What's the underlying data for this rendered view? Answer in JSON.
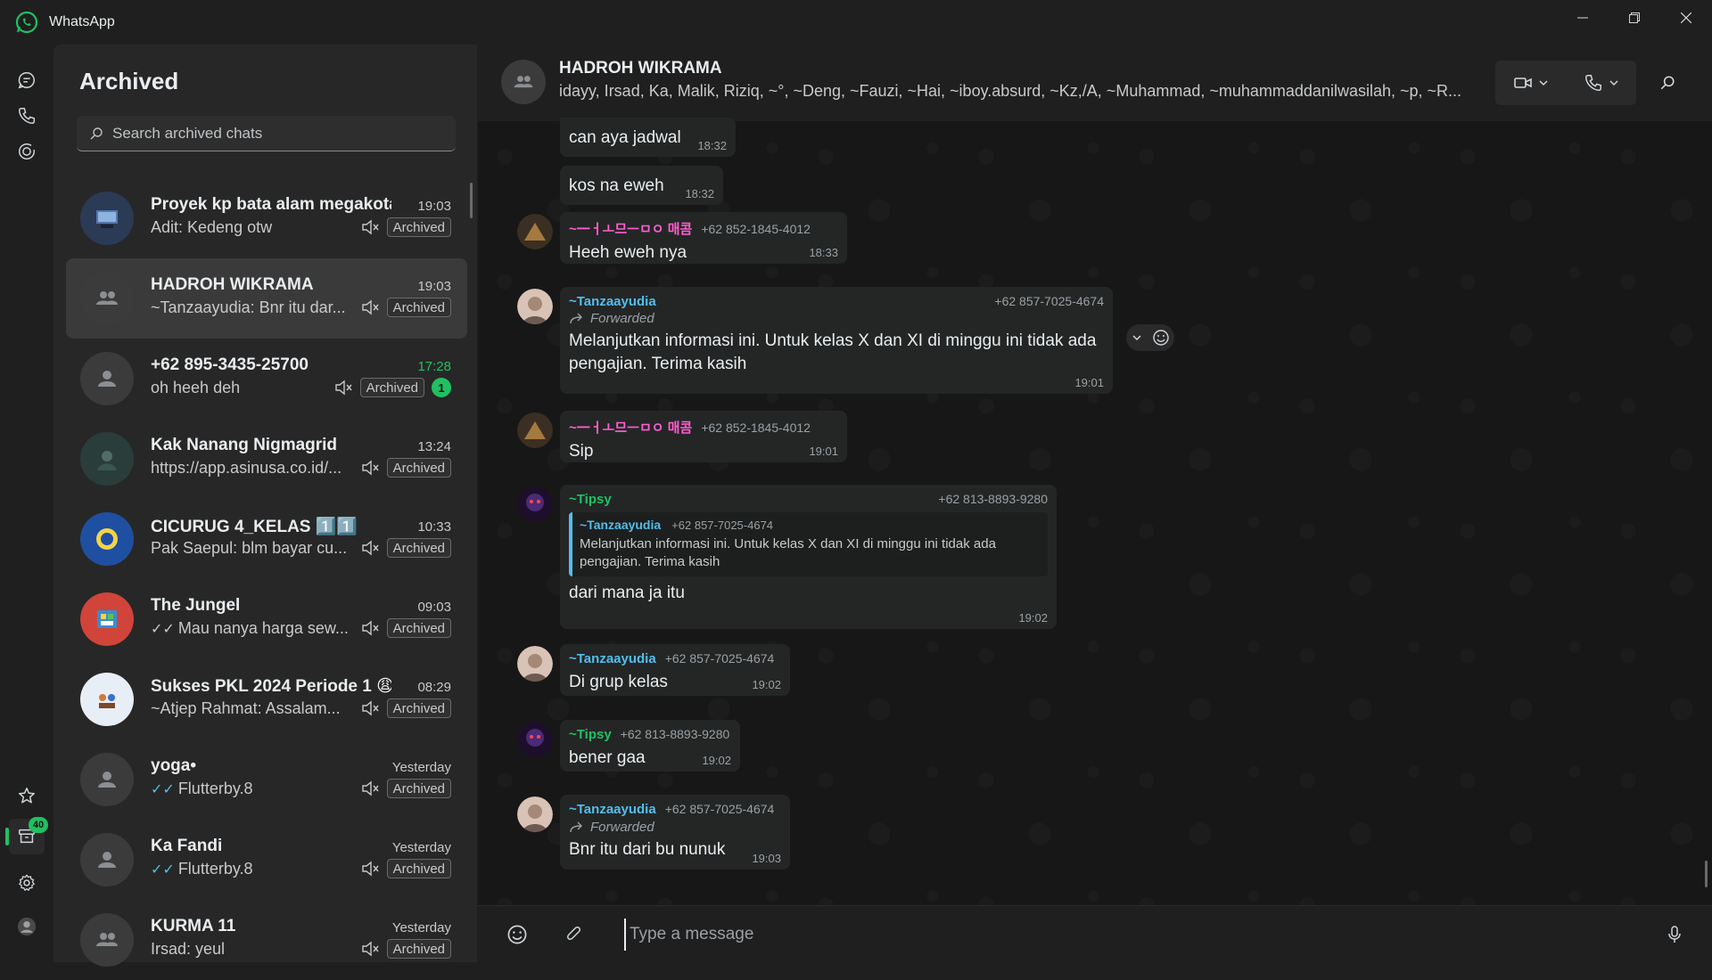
{
  "app": {
    "title": "WhatsApp",
    "accent": "#21c063"
  },
  "rail": {
    "archived_badge": "40"
  },
  "sidebar": {
    "title": "Archived",
    "search_placeholder": "Search archived chats",
    "chats": [
      {
        "name": "Proyek kp bata alam megakota",
        "time": "19:03",
        "preview": "Adit: Kedeng otw",
        "badge": "Archived"
      },
      {
        "name": "HADROH WIKRAMA",
        "time": "19:03",
        "preview": "~Tanzaayudia: Bnr itu dar...",
        "badge": "Archived"
      },
      {
        "name": "+62 895-3435-25700",
        "time": "17:28",
        "preview": "oh heeh deh",
        "badge": "Archived",
        "unread": "1"
      },
      {
        "name": "Kak Nanang Nigmagrid",
        "time": "13:24",
        "preview": "https://app.asinusa.co.id/...",
        "badge": "Archived"
      },
      {
        "name": "CICURUG 4_KELAS 1️⃣1️⃣",
        "time": "10:33",
        "preview": "Pak Saepul: blm bayar cu...",
        "badge": "Archived"
      },
      {
        "name": "The Jungel",
        "time": "09:03",
        "preview": "Mau nanya harga sew...",
        "badge": "Archived"
      },
      {
        "name": "Sukses PKL 2024 Periode 1 😩😩",
        "time": "08:29",
        "preview": "~Atjep Rahmat: Assalam...",
        "badge": "Archived"
      },
      {
        "name": "yoga•",
        "time": "Yesterday",
        "preview": "Flutterby.8",
        "badge": "Archived"
      },
      {
        "name": "Ka Fandi",
        "time": "Yesterday",
        "preview": "Flutterby.8",
        "badge": "Archived"
      },
      {
        "name": "KURMA 11",
        "time": "Yesterday",
        "preview": "Irsad: yeul",
        "badge": "Archived"
      }
    ]
  },
  "conversation": {
    "title": "HADROH WIKRAMA",
    "members": "idayy, Irsad, Ka, Malik, Riziq, ~°, ~Deng, ~Fauzi, ~Hai, ~iboy.absurd, ~Kz,/A, ~Muhammad, ~muhammaddanilwasilah, ~p, ~R...",
    "messages": [
      {
        "text": "can aya jadwal",
        "time": "18:32"
      },
      {
        "text": "kos na eweh",
        "time": "18:32"
      },
      {
        "sender": "~一ㅓㅗ므ㅡㅁㅇ 매콤",
        "phone": "+62 852-1845-4012",
        "text": "Heeh eweh nya",
        "time": "18:33"
      },
      {
        "sender": "~Tanzaayudia",
        "phone": "+62 857-7025-4674",
        "forwarded": "Forwarded",
        "text": "Melanjutkan informasi ini. Untuk kelas X dan XI di minggu ini tidak ada pengajian. Terima kasih",
        "time": "19:01"
      },
      {
        "sender": "~一ㅓㅗ므ㅡㅁㅇ 매콤",
        "phone": "+62 852-1845-4012",
        "text": "Sip",
        "time": "19:01"
      },
      {
        "sender": "~Tipsy",
        "phone": "+62 813-8893-9280",
        "quote_name": "~Tanzaayudia",
        "quote_phone": "+62 857-7025-4674",
        "quote_text": "Melanjutkan informasi ini. Untuk kelas X dan XI di minggu ini tidak ada pengajian. Terima kasih",
        "text": "dari mana ja itu",
        "time": "19:02"
      },
      {
        "sender": "~Tanzaayudia",
        "phone": "+62 857-7025-4674",
        "text": "Di grup kelas",
        "time": "19:02"
      },
      {
        "sender": "~Tipsy",
        "phone": "+62 813-8893-9280",
        "text": "bener gaa",
        "time": "19:02"
      },
      {
        "sender": "~Tanzaayudia",
        "phone": "+62 857-7025-4674",
        "forwarded": "Forwarded",
        "text": "Bnr itu dari bu nunuk",
        "time": "19:03"
      }
    ],
    "sender_colors": {
      "mekom": "#ff5fd0",
      "tanza": "#53bdeb",
      "tipsy": "#21c063"
    }
  },
  "composer": {
    "placeholder": "Type a message"
  }
}
